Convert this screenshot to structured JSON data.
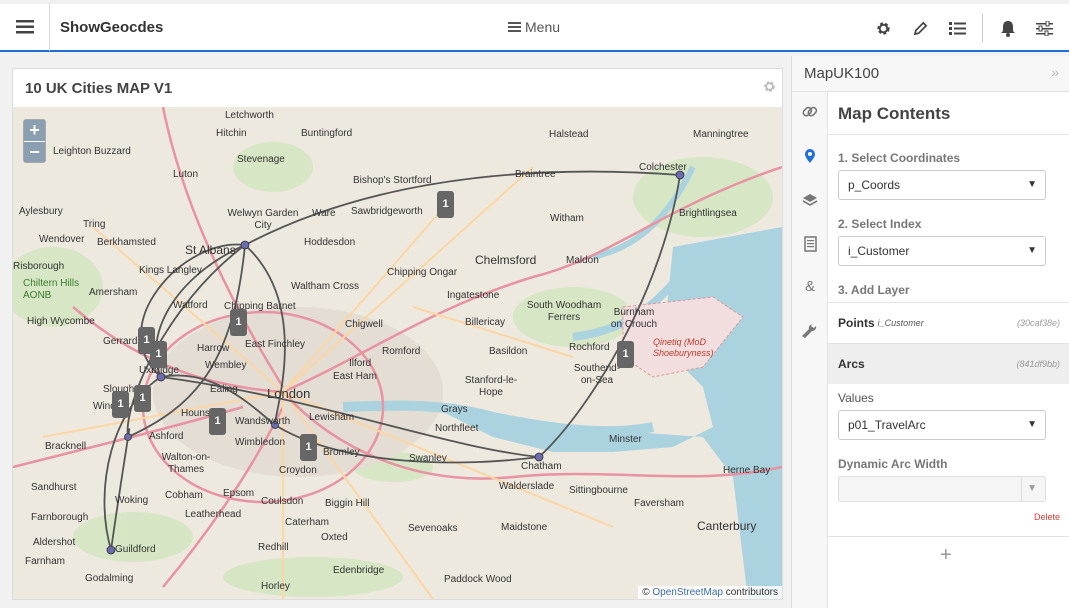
{
  "app": {
    "title": "ShowGeocdes",
    "menu_label": "Menu"
  },
  "toolbar": {
    "icons": [
      "settings-icon",
      "pencil-icon",
      "list-icon",
      "bell-icon",
      "sliders-icon"
    ]
  },
  "map": {
    "title": "10 UK Cities MAP V1",
    "zoom_in": "+",
    "zoom_out": "−",
    "attribution_prefix": "© ",
    "attribution_link": "OpenStreetMap",
    "attribution_suffix": " contributors",
    "places": [
      "Letchworth",
      "Hitchin",
      "Buntingford",
      "Halstead",
      "Manningtree",
      "Leighton Buzzard",
      "Stevenage",
      "Luton",
      "Bishop's Stortford",
      "Braintree",
      "Colchester",
      "Welwyn Garden City",
      "Ware",
      "Sawbridgeworth",
      "Witham",
      "Brightlingsea",
      "Aylesbury",
      "Tring",
      "Hoddesdon",
      "Berkhamsted",
      "St Albans",
      "Wendover",
      "Kings Langley",
      "Chelmsford",
      "Maldon",
      "Risborough",
      "Chipping Ongar",
      "Amersham",
      "Waltham Cross",
      "Ingatestone",
      "Chiltern Hills AONB",
      "Watford",
      "Chipping Barnet",
      "South Woodham Ferrers",
      "High Wycombe",
      "Burnham on Crouch",
      "Chigwell",
      "Billericay",
      "Gerrards",
      "Harrow",
      "East Finchley",
      "Romford",
      "Basildon",
      "Rochford",
      "Qinetiq (MoD Shoeburyness)",
      "Wembley",
      "Ilford",
      "Southend-on-Sea",
      "Uxbridge",
      "Ealing",
      "London",
      "East Ham",
      "Stanford-le-Hope",
      "Slough",
      "Grays",
      "Windsor",
      "Hounslow",
      "Lewisham",
      "Ashford",
      "Wandsworth",
      "Northfleet",
      "Minster",
      "Bracknell",
      "Walton-on-Thames",
      "Wimbledon",
      "Bromley",
      "Swanley",
      "Chatham",
      "Croydon",
      "Herne Bay",
      "Sandhurst",
      "Woking",
      "Cobham",
      "Epsom",
      "Coulsdon",
      "Walderslade",
      "Sittingbourne",
      "Biggin Hill",
      "Farnborough",
      "Leatherhead",
      "Faversham",
      "Caterham",
      "Sevenoaks",
      "Maidstone",
      "Canterbury",
      "Aldershot",
      "Guildford",
      "Oxted",
      "Redhill",
      "Farnham",
      "Godalming",
      "Edenbridge",
      "Horley",
      "Paddock Wood"
    ],
    "clusters": [
      "1",
      "1",
      "1",
      "1",
      "1",
      "1",
      "1",
      "1",
      "1",
      "1"
    ]
  },
  "sidebar": {
    "header": "MapUK100",
    "collapse": "»",
    "rail": [
      "link-icon",
      "map-marker-icon",
      "layers-icon",
      "document-icon",
      "ampersand-icon",
      "wrench-icon"
    ],
    "title": "Map Contents",
    "step1_label": "1. Select Coordinates",
    "step1_value": "p_Coords",
    "step2_label": "2. Select Index",
    "step2_value": "i_Customer",
    "step3_label": "3. Add Layer",
    "layers": [
      {
        "name": "Points",
        "sub": "i_Customer",
        "id": "(30caf38e)"
      },
      {
        "name": "Arcs",
        "sub": "",
        "id": "(841df9bb)"
      }
    ],
    "values_label": "Values",
    "values_value": "p01_TravelArc",
    "arc_width_label": "Dynamic Arc Width",
    "arc_width_value": "",
    "delete_label": "Delete",
    "add_label": "+"
  }
}
